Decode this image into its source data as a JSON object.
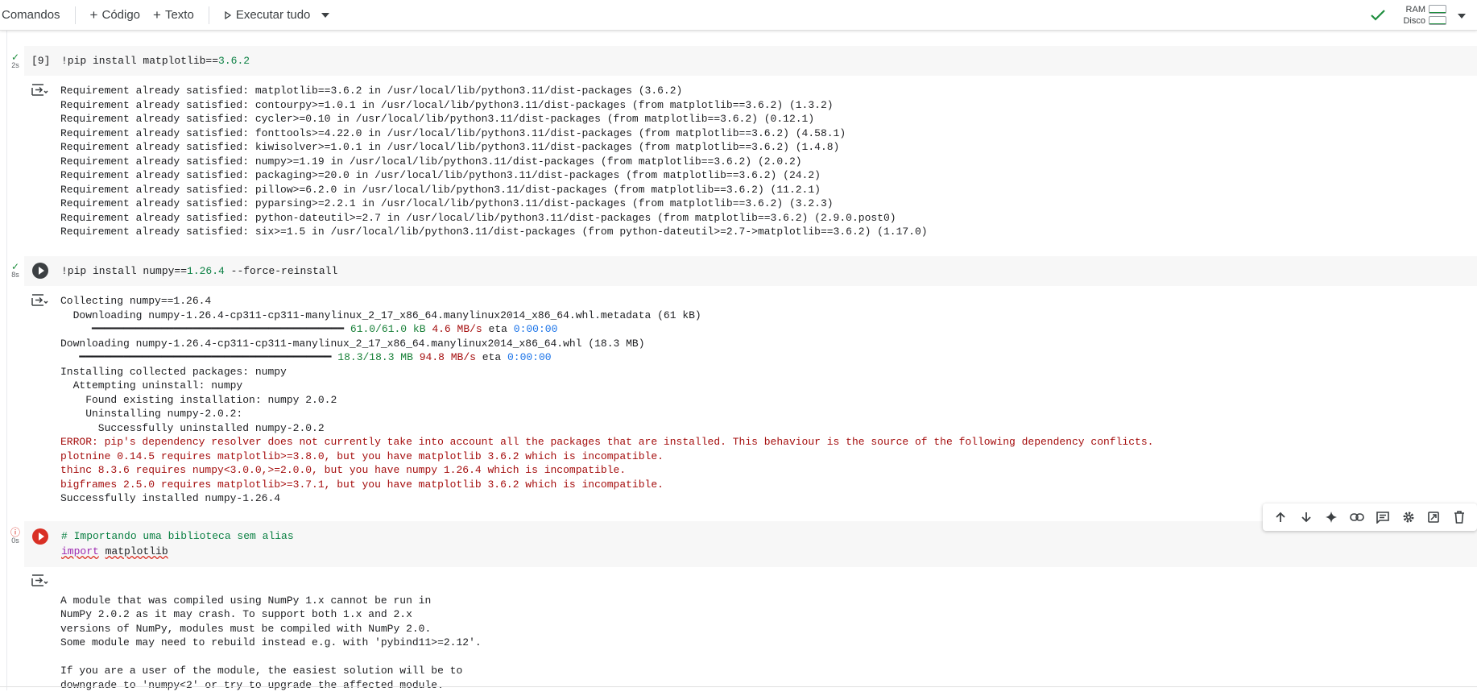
{
  "toolbar": {
    "commands_label": "Comandos",
    "code_label": "Código",
    "text_label": "Texto",
    "run_all_label": "Executar tudo",
    "ram_label": "RAM",
    "disk_label": "Disco"
  },
  "cells": [
    {
      "status_time": "2s",
      "exec_count": "[9]",
      "code_prefix": "!pip install matplotlib==",
      "code_version": "3.6.2",
      "code_suffix": "",
      "output_lines": [
        "Requirement already satisfied: matplotlib==3.6.2 in /usr/local/lib/python3.11/dist-packages (3.6.2)",
        "Requirement already satisfied: contourpy>=1.0.1 in /usr/local/lib/python3.11/dist-packages (from matplotlib==3.6.2) (1.3.2)",
        "Requirement already satisfied: cycler>=0.10 in /usr/local/lib/python3.11/dist-packages (from matplotlib==3.6.2) (0.12.1)",
        "Requirement already satisfied: fonttools>=4.22.0 in /usr/local/lib/python3.11/dist-packages (from matplotlib==3.6.2) (4.58.1)",
        "Requirement already satisfied: kiwisolver>=1.0.1 in /usr/local/lib/python3.11/dist-packages (from matplotlib==3.6.2) (1.4.8)",
        "Requirement already satisfied: numpy>=1.19 in /usr/local/lib/python3.11/dist-packages (from matplotlib==3.6.2) (2.0.2)",
        "Requirement already satisfied: packaging>=20.0 in /usr/local/lib/python3.11/dist-packages (from matplotlib==3.6.2) (24.2)",
        "Requirement already satisfied: pillow>=6.2.0 in /usr/local/lib/python3.11/dist-packages (from matplotlib==3.6.2) (11.2.1)",
        "Requirement already satisfied: pyparsing>=2.2.1 in /usr/local/lib/python3.11/dist-packages (from matplotlib==3.6.2) (3.2.3)",
        "Requirement already satisfied: python-dateutil>=2.7 in /usr/local/lib/python3.11/dist-packages (from matplotlib==3.6.2) (2.9.0.post0)",
        "Requirement already satisfied: six>=1.5 in /usr/local/lib/python3.11/dist-packages (from python-dateutil>=2.7->matplotlib==3.6.2) (1.17.0)"
      ]
    },
    {
      "status_time": "8s",
      "code_prefix": "!pip install numpy==",
      "code_version": "1.26.4",
      "code_suffix": " --force-reinstall",
      "out": {
        "l1": "Collecting numpy==1.26.4",
        "l2": "  Downloading numpy-1.26.4-cp311-cp311-manylinux_2_17_x86_64.manylinux2014_x86_64.whl.metadata (61 kB)",
        "p1_bar": "     ━━━━━━━━━━━━━━━━━━━━━━━━━━━━━━━━━━━━━━━━",
        "p1_size": "61.0/61.0 kB",
        "p1_speed": "4.6 MB/s",
        "p1_eta": "0:00:00",
        "l3": "Downloading numpy-1.26.4-cp311-cp311-manylinux_2_17_x86_64.manylinux2014_x86_64.whl (18.3 MB)",
        "p2_bar": "   ━━━━━━━━━━━━━━━━━━━━━━━━━━━━━━━━━━━━━━━━",
        "p2_size": "18.3/18.3 MB",
        "p2_speed": "94.8 MB/s",
        "p2_eta": "0:00:00",
        "l4": "Installing collected packages: numpy",
        "l5": "  Attempting uninstall: numpy",
        "l6": "    Found existing installation: numpy 2.0.2",
        "l7": "    Uninstalling numpy-2.0.2:",
        "l8": "      Successfully uninstalled numpy-2.0.2",
        "e1": "ERROR: pip's dependency resolver does not currently take into account all the packages that are installed. This behaviour is the source of the following dependency conflicts.",
        "e2": "plotnine 0.14.5 requires matplotlib>=3.8.0, but you have matplotlib 3.6.2 which is incompatible.",
        "e3": "thinc 8.3.6 requires numpy<3.0.0,>=2.0.0, but you have numpy 1.26.4 which is incompatible.",
        "e4": "bigframes 2.5.0 requires matplotlib>=3.7.1, but you have matplotlib 3.6.2 which is incompatible.",
        "l9": "Successfully installed numpy-1.26.4"
      }
    },
    {
      "status_time": "0s",
      "comment": "# Importando uma biblioteca sem alias",
      "kw": "import",
      "module": "matplotlib",
      "output_lines": [
        "",
        "A module that was compiled using NumPy 1.x cannot be run in",
        "NumPy 2.0.2 as it may crash. To support both 1.x and 2.x",
        "versions of NumPy, modules must be compiled with NumPy 2.0.",
        "Some module may need to rebuild instead e.g. with 'pybind11>=2.12'.",
        "",
        "If you are a user of the module, the easiest solution will be to",
        "downgrade to 'numpy<2' or try to upgrade the affected module."
      ]
    }
  ]
}
